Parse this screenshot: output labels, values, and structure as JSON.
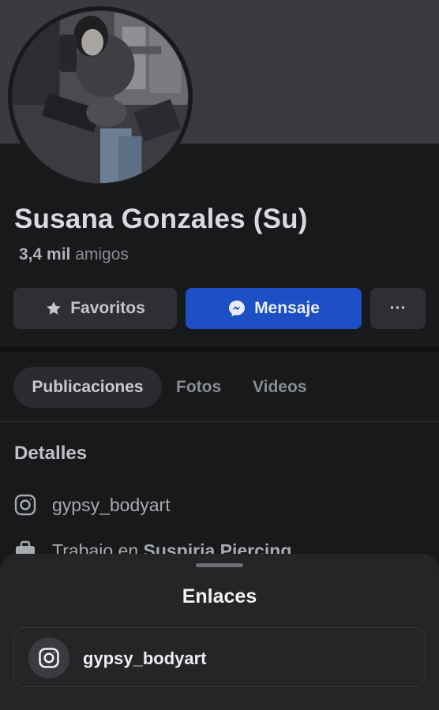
{
  "profile": {
    "name": "Susana Gonzales (Su)",
    "friends_count": "3,4 mil",
    "friends_label": "amigos"
  },
  "actions": {
    "favorites": "Favoritos",
    "message": "Mensaje",
    "more": "···"
  },
  "tabs": [
    {
      "label": "Publicaciones",
      "selected": true
    },
    {
      "label": "Fotos",
      "selected": false
    },
    {
      "label": "Videos",
      "selected": false
    }
  ],
  "details": {
    "title": "Detalles",
    "instagram": "gypsy_bodyart",
    "work_prefix": "Trabajo en",
    "work_place": "Suspiria Piercing"
  },
  "sheet": {
    "title": "Enlaces",
    "links": [
      {
        "icon": "instagram-icon",
        "label": "gypsy_bodyart"
      }
    ]
  },
  "colors": {
    "background": "#18191a",
    "accent": "#1d4fc4"
  }
}
